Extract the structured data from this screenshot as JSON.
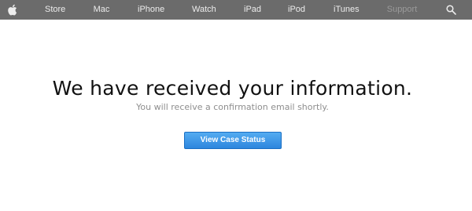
{
  "nav": {
    "logo_icon": "apple-logo-icon",
    "items": [
      {
        "label": "Store"
      },
      {
        "label": "Mac"
      },
      {
        "label": "iPhone"
      },
      {
        "label": "Watch"
      },
      {
        "label": "iPad"
      },
      {
        "label": "iPod"
      },
      {
        "label": "iTunes"
      },
      {
        "label": "Support",
        "state": "dimmed"
      }
    ],
    "search_icon": "search-icon",
    "colors": {
      "background": "#6b6b6b",
      "text": "#ececec",
      "dimmed_text": "#9a9a9a"
    }
  },
  "main": {
    "headline": "We have received your information.",
    "subtext": "You will receive a confirmation email shortly.",
    "cta_label": "View Case Status",
    "cta_color": "#2d86de"
  }
}
